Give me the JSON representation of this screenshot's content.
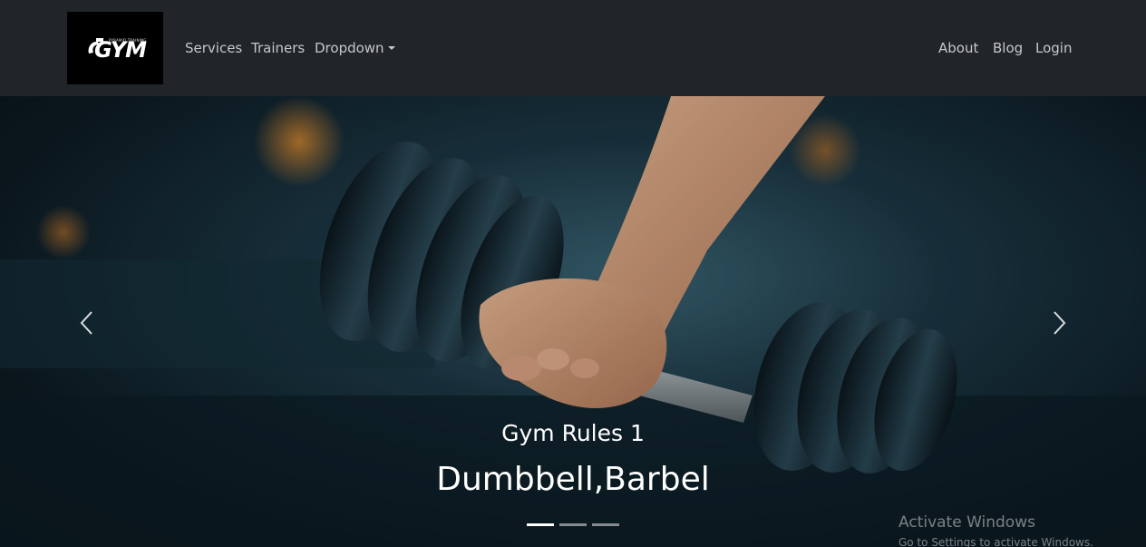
{
  "brand": {
    "name": "GYM",
    "tagline": "PYRAMID TRAINING"
  },
  "nav": {
    "left": [
      {
        "label": "Services"
      },
      {
        "label": "Trainers"
      },
      {
        "label": "Dropdown"
      }
    ],
    "right": [
      {
        "label": "About"
      },
      {
        "label": "Blog"
      },
      {
        "label": "Login"
      }
    ]
  },
  "carousel": {
    "slide_title": "Gym Rules 1",
    "slide_subtitle": "Dumbbell,Barbel",
    "slide_count": 3,
    "active_index": 0,
    "prev_icon": "chevron-left-icon",
    "next_icon": "chevron-right-icon"
  },
  "watermark": {
    "title": "Activate Windows",
    "subtitle": "Go to Settings to activate Windows."
  },
  "colors": {
    "navbar": "#212529",
    "nav_text": "#c6c8ca",
    "brand_bg": "#000000"
  }
}
